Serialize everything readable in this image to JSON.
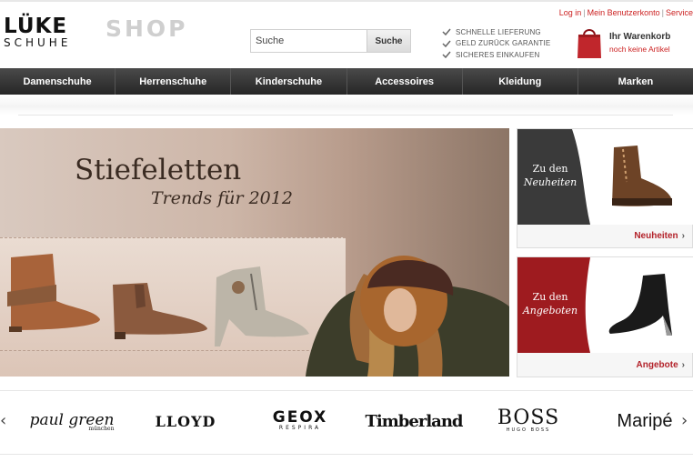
{
  "header": {
    "logo_main": "LÜKE",
    "logo_sub": "SCHUHE",
    "logo_shop": "SHOP",
    "top_links": [
      "Log in",
      "Mein Benutzerkonto",
      "Service"
    ],
    "search": {
      "placeholder": "Suche",
      "value": "",
      "button_label": "Suche"
    },
    "benefits": [
      "SCHNELLE LIEFERUNG",
      "GELD ZURÜCK GARANTIE",
      "SICHERES EINKAUFEN"
    ],
    "cart": {
      "title": "Ihr Warenkorb",
      "subtitle": "noch keine Artikel"
    }
  },
  "nav": {
    "items": [
      "Damenschuhe",
      "Herrenschuhe",
      "Kinderschuhe",
      "Accessoires",
      "Kleidung",
      "Marken"
    ]
  },
  "hero": {
    "title": "Stiefeletten",
    "subtitle": "Trends für 2012"
  },
  "promos": [
    {
      "badge_line1": "Zu den",
      "badge_line2": "Neuheiten",
      "link": "Neuheiten",
      "badge_color": "#3a3a3a"
    },
    {
      "badge_line1": "Zu den",
      "badge_line2": "Angeboten",
      "link": "Angebote",
      "badge_color": "#9e1b1f"
    }
  ],
  "brands": {
    "prev_arrow": "‹",
    "next_arrow": "›",
    "paul_green": "paul green",
    "paul_green_sub": "münchen",
    "lloyd": "LLOYD",
    "geox": "GEOX",
    "geox_sub": "RESPIRA",
    "timberland": "Timberland",
    "boss": "BOSS",
    "boss_sub": "HUGO BOSS",
    "maripe": "Maripé"
  },
  "colors": {
    "accent_red": "#b3222a",
    "nav_dark": "#2e2e2e"
  },
  "icons": {
    "benefit": "check-icon",
    "cart": "shopping-bag-icon"
  }
}
